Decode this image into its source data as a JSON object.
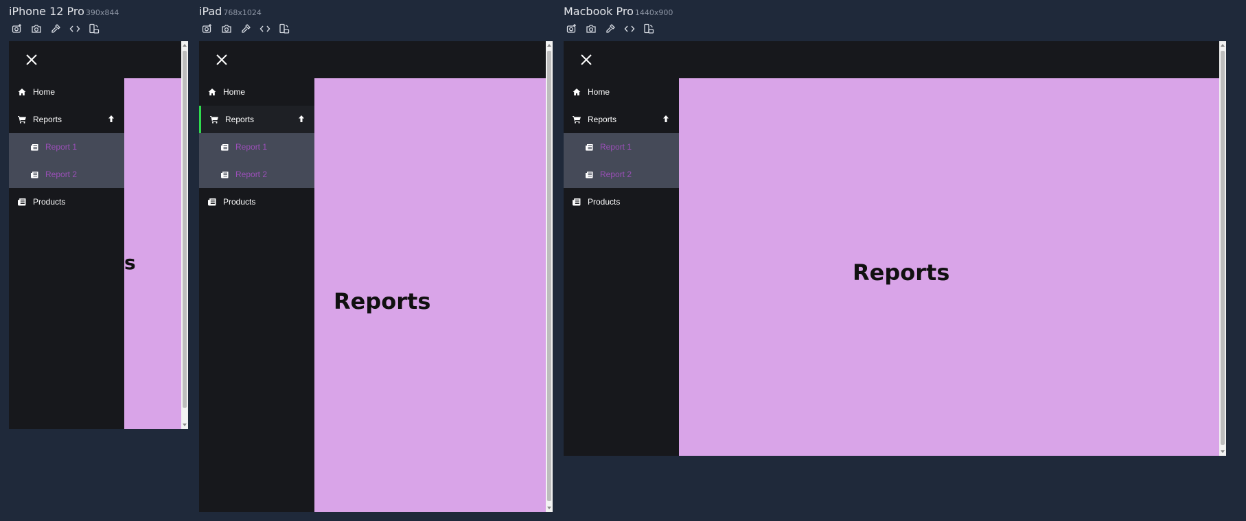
{
  "devices": [
    {
      "name": "iPhone 12 Pro",
      "size": "390x844",
      "heading": "Reports"
    },
    {
      "name": "iPad",
      "size": "768x1024",
      "heading": "Reports"
    },
    {
      "name": "Macbook Pro",
      "size": "1440x900",
      "heading": "Reports"
    }
  ],
  "toolbar": {
    "icons": [
      "camera-plus-icon",
      "camera-icon",
      "eyedropper-icon",
      "code-icon",
      "rotate-device-icon"
    ]
  },
  "nav": {
    "home": "Home",
    "reports": "Reports",
    "report1": "Report 1",
    "report2": "Report 2",
    "products": "Products",
    "iphone_partial_heading": "s"
  },
  "colors": {
    "background": "#1f293a",
    "sidebar": "#17181c",
    "submenu": "#454a58",
    "submenu_text": "#9b4fb8",
    "content": "#d9a4e8",
    "active_indicator": "#2fdc4e"
  }
}
